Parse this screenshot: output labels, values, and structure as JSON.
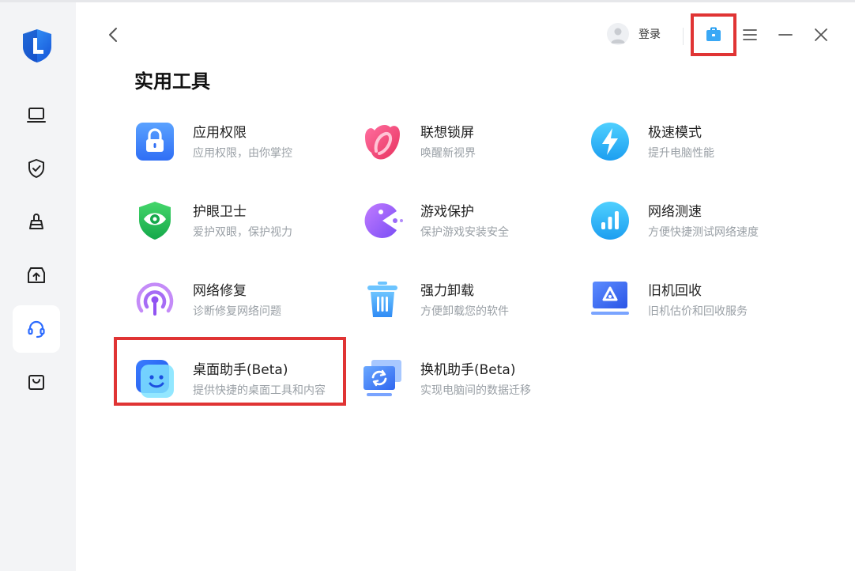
{
  "sidebar": {
    "nav": [
      {
        "icon": "laptop-icon"
      },
      {
        "icon": "shield-check-icon"
      },
      {
        "icon": "cleaning-icon"
      },
      {
        "icon": "driver-upload-icon"
      },
      {
        "icon": "headset-icon",
        "active": true
      },
      {
        "icon": "shopping-bag-icon"
      }
    ]
  },
  "header": {
    "login_label": "登录"
  },
  "page": {
    "title": "实用工具"
  },
  "tools": [
    {
      "name": "应用权限",
      "desc": "应用权限，由你掌控",
      "icon": "lock-icon"
    },
    {
      "name": "联想锁屏",
      "desc": "唤醒新视界",
      "icon": "lenovo-lockscreen-icon"
    },
    {
      "name": "极速模式",
      "desc": "提升电脑性能",
      "icon": "lightning-icon"
    },
    {
      "name": "护眼卫士",
      "desc": "爱护双眼，保护视力",
      "icon": "eye-shield-icon"
    },
    {
      "name": "游戏保护",
      "desc": "保护游戏安装安全",
      "icon": "pacman-icon"
    },
    {
      "name": "网络测速",
      "desc": "方便快捷测试网络速度",
      "icon": "bar-chart-icon"
    },
    {
      "name": "网络修复",
      "desc": "诊断修复网络问题",
      "icon": "wifi-signal-icon"
    },
    {
      "name": "强力卸载",
      "desc": "方便卸载您的软件",
      "icon": "trash-icon"
    },
    {
      "name": "旧机回收",
      "desc": "旧机估价和回收服务",
      "icon": "recycle-monitor-icon"
    },
    {
      "name": "桌面助手(Beta)",
      "desc": "提供快捷的桌面工具和内容",
      "icon": "smiley-icon"
    },
    {
      "name": "换机助手(Beta)",
      "desc": "实现电脑间的数据迁移",
      "icon": "migrate-icon"
    }
  ]
}
